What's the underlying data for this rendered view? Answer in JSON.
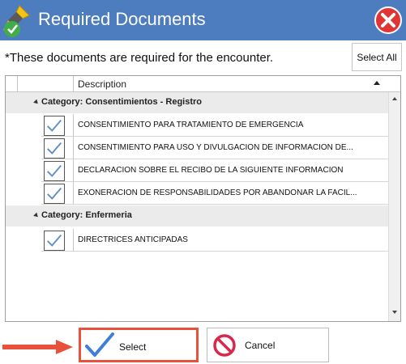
{
  "window": {
    "title": "Required Documents",
    "app_icon": "brush-icon",
    "close_icon": "close-icon",
    "accent_color": "#4d7dbf"
  },
  "subheader": {
    "text": "*These documents are required for the encounter.",
    "select_all_label": "Select All"
  },
  "grid": {
    "column_header": "Description",
    "sort": "ascending",
    "categories": [
      {
        "label": "Category: Consentimientos - Registro",
        "expanded": true,
        "documents": [
          {
            "description": "CONSENTIMIENTO PARA TRATAMIENTO DE EMERGENCIA",
            "checked": true
          },
          {
            "description": "CONSENTIMIENTO PARA USO Y DIVULGACION DE INFORMACION DE...",
            "checked": true
          },
          {
            "description": "DECLARACION SOBRE EL RECIBO DE LA SIGUIENTE INFORMACION",
            "checked": true
          },
          {
            "description": "EXONERACION DE RESPONSABILIDADES POR ABANDONAR LA FACIL...",
            "checked": true
          }
        ]
      },
      {
        "label": "Category: Enfermeria",
        "expanded": true,
        "documents": [
          {
            "description": "DIRECTRICES ANTICIPADAS",
            "checked": true
          }
        ]
      }
    ]
  },
  "footer": {
    "select_label": "Select",
    "cancel_label": "Cancel",
    "select_highlight_color": "#e8523c"
  }
}
